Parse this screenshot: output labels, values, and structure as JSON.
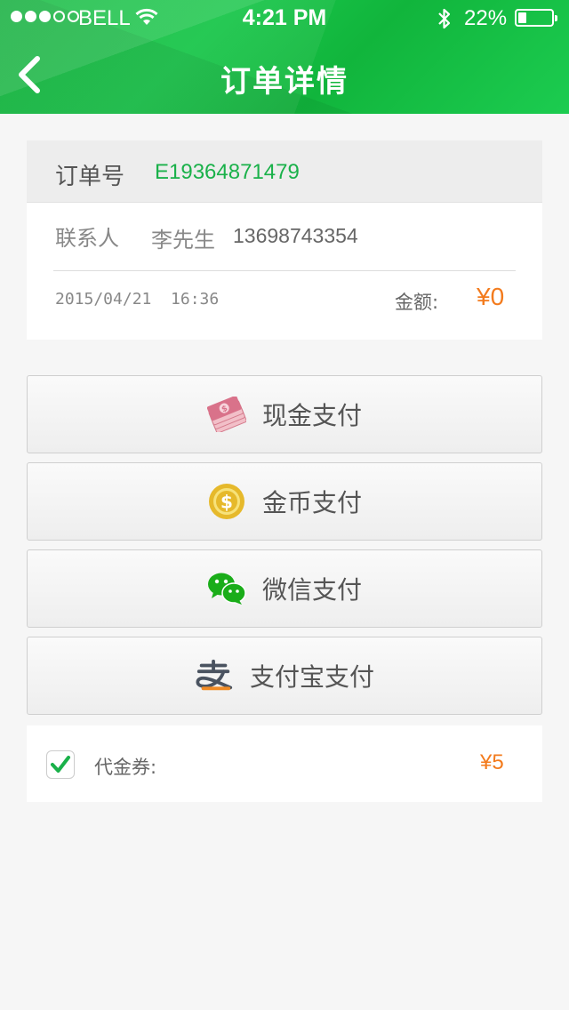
{
  "status_bar": {
    "carrier": "BELL",
    "time": "4:21 PM",
    "battery": "22%"
  },
  "nav": {
    "title": "订单详情"
  },
  "order": {
    "order_no_label": "订单号",
    "order_no": "E19364871479",
    "contact_label": "联系人",
    "contact_name": "李先生",
    "contact_phone": "13698743354",
    "date": "2015/04/21  16:36",
    "amount_label": "金额:",
    "amount": "¥0"
  },
  "payment_methods": [
    {
      "label": "现金支付",
      "icon": "cash-icon"
    },
    {
      "label": "金币支付",
      "icon": "gold-coin-icon"
    },
    {
      "label": "微信支付",
      "icon": "wechat-icon"
    },
    {
      "label": "支付宝支付",
      "icon": "alipay-icon"
    }
  ],
  "voucher": {
    "label": "代金券:",
    "value": "¥5",
    "checked": true
  },
  "colors": {
    "accent_green": "#1ab14a",
    "header_green": "#16c046",
    "amount_orange": "#f37b1d"
  }
}
